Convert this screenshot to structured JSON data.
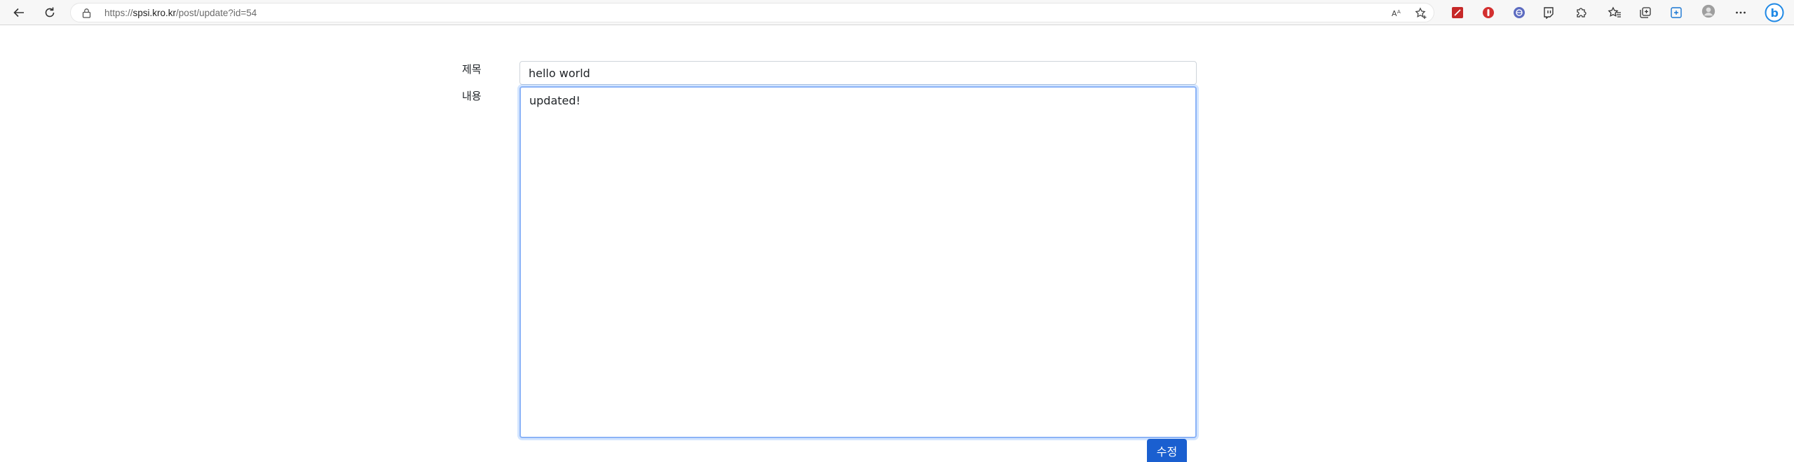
{
  "browser": {
    "url_scheme": "https://",
    "url_host": "spsi.kro.kr",
    "url_path": "/post/update?id=54"
  },
  "form": {
    "title_label": "제목",
    "content_label": "내용",
    "title_value": "hello world",
    "content_value": "updated!",
    "submit_label": "수정"
  },
  "colors": {
    "accent": "#1a5fd0",
    "focus_border": "#8bb3f7"
  }
}
